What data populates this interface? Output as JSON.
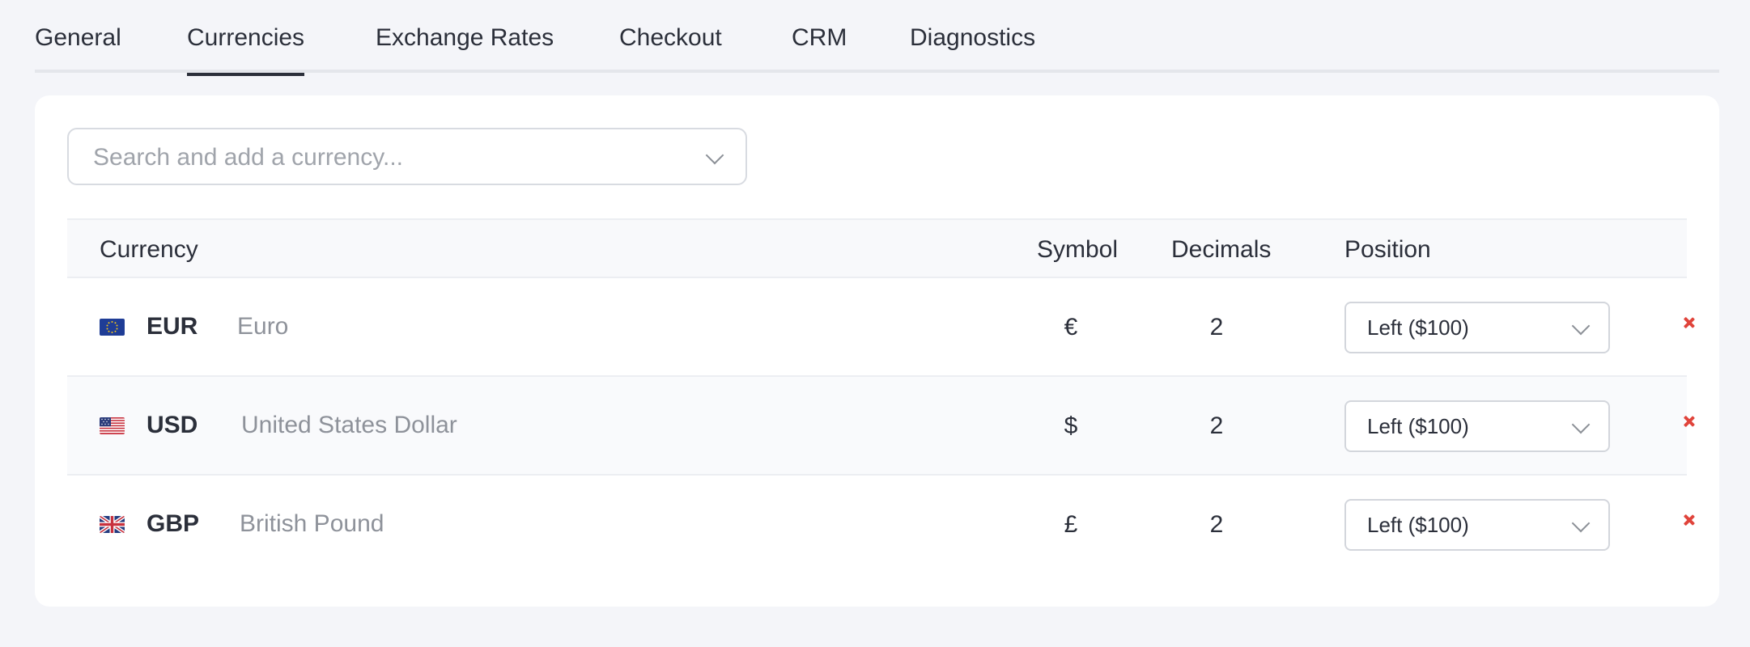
{
  "tabs": [
    {
      "label": "General"
    },
    {
      "label": "Currencies"
    },
    {
      "label": "Exchange Rates"
    },
    {
      "label": "Checkout"
    },
    {
      "label": "CRM"
    },
    {
      "label": "Diagnostics"
    }
  ],
  "active_tab": "Currencies",
  "search": {
    "placeholder": "Search and add a currency..."
  },
  "table": {
    "headers": {
      "currency": "Currency",
      "symbol": "Symbol",
      "decimals": "Decimals",
      "position": "Position"
    },
    "rows": [
      {
        "code": "EUR",
        "name": "Euro",
        "flag": "eu-flag-icon",
        "symbol": "€",
        "decimals": "2",
        "position": "Left ($100)"
      },
      {
        "code": "USD",
        "name": "United States Dollar",
        "flag": "us-flag-icon",
        "symbol": "$",
        "decimals": "2",
        "position": "Left ($100)"
      },
      {
        "code": "GBP",
        "name": "British Pound",
        "flag": "uk-flag-icon",
        "symbol": "£",
        "decimals": "2",
        "position": "Left ($100)"
      }
    ]
  },
  "colors": {
    "background": "#f4f5f9",
    "text": "#2b2f3a",
    "muted_text": "#8e929a",
    "remove": "#e0443b"
  }
}
